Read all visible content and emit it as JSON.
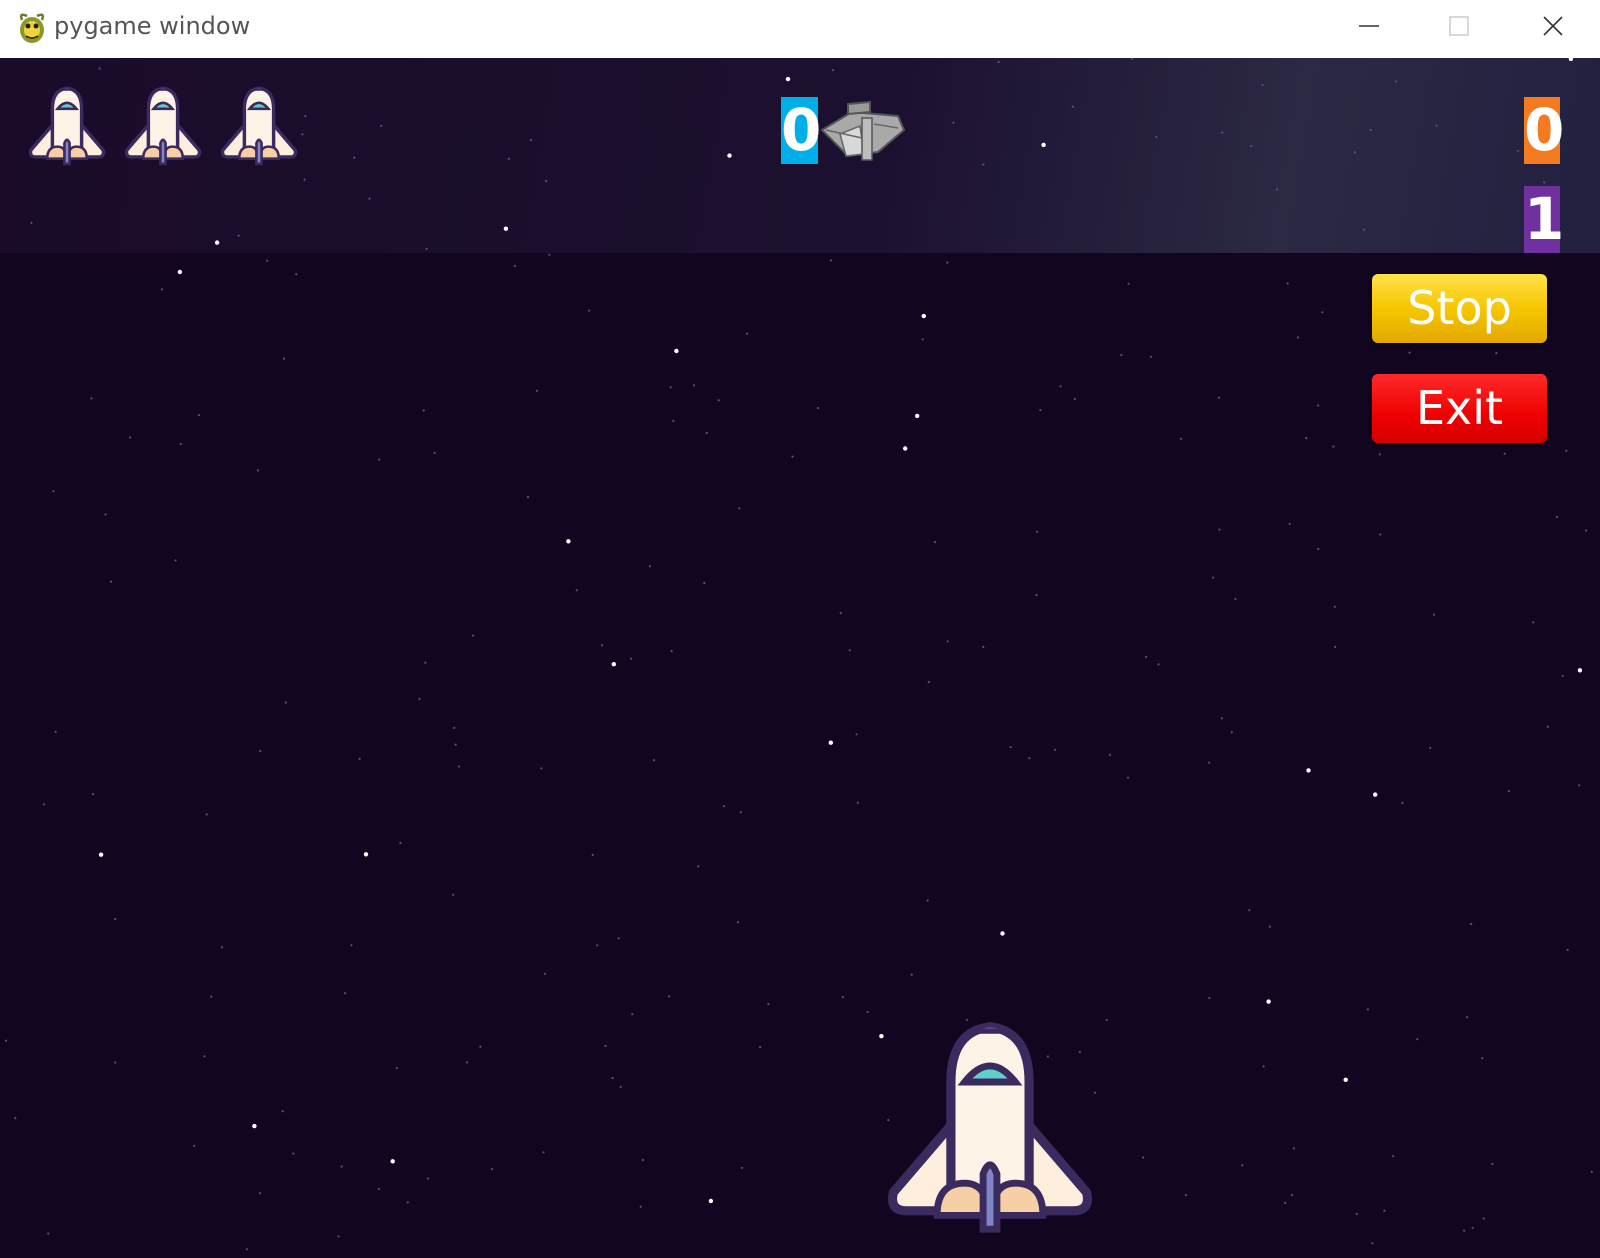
{
  "window": {
    "title": "pygame window",
    "controls": [
      "minimize",
      "maximize",
      "close"
    ]
  },
  "hud": {
    "lives": 3,
    "score": "0",
    "counter_orange": "0",
    "counter_purple": "1"
  },
  "buttons": {
    "stop": "Stop",
    "exit": "Exit"
  },
  "colors": {
    "background": "#12051f",
    "score_box": "#00aee8",
    "counter_orange": "#f47a20",
    "counter_purple": "#7030a0",
    "stop_button": "#f6c700",
    "exit_button": "#ee0000"
  },
  "icons": {
    "app": "pygame-snake-icon",
    "lives": "space-shuttle-icon",
    "enemy": "gray-spaceship-icon",
    "player": "space-shuttle-icon"
  }
}
